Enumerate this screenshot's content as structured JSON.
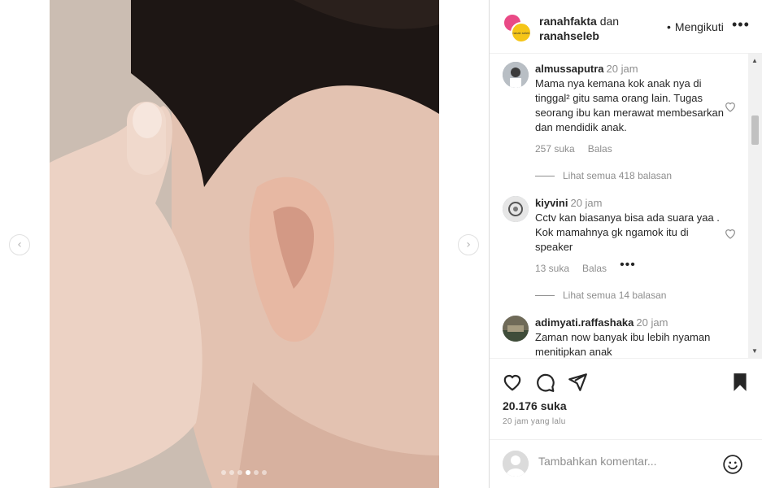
{
  "post": {
    "author": "ranahfakta",
    "joiner": "dan",
    "coauthor": "ranahseleb",
    "coauthor_avatar_text": "ranah seleb",
    "follow_label": "Mengikuti",
    "more_label": "•••",
    "likes": "20.176 suka",
    "time_ago": "20 jam yang lalu"
  },
  "carousel": {
    "prev_icon": "chevron-left-icon",
    "next_icon": "chevron-right-icon",
    "prev_glyph": "‹",
    "next_glyph": "›",
    "slide_count": 6,
    "active_index": 3
  },
  "comments": [
    {
      "user": "almussaputra",
      "time": "20 jam",
      "text": "Mama nya kemana kok anak nya di tinggal² gitu sama orang lain. Tugas seorang ibu kan merawat membesarkan dan mendidik anak.",
      "likes": "257 suka",
      "reply": "Balas",
      "replies": "Lihat semua 418 balasan"
    },
    {
      "user": "kiyvini",
      "time": "20 jam",
      "text": "Cctv kan biasanya bisa ada suara yaa . Kok mamahnya gk ngamok itu di speaker",
      "likes": "13 suka",
      "reply": "Balas",
      "more": "•••",
      "replies": "Lihat semua 14 balasan"
    },
    {
      "user": "adimyati.raffashaka",
      "time": "20 jam",
      "text": "Zaman now banyak ibu lebih nyaman menitipkan anak"
    }
  ],
  "add_comment": {
    "placeholder": "Tambahkan komentar..."
  },
  "colors": {
    "text": "#262626",
    "muted": "#8e8e8e",
    "border": "#dbdbdb",
    "avatar1": "#e94a86",
    "avatar2": "#f5c518"
  }
}
